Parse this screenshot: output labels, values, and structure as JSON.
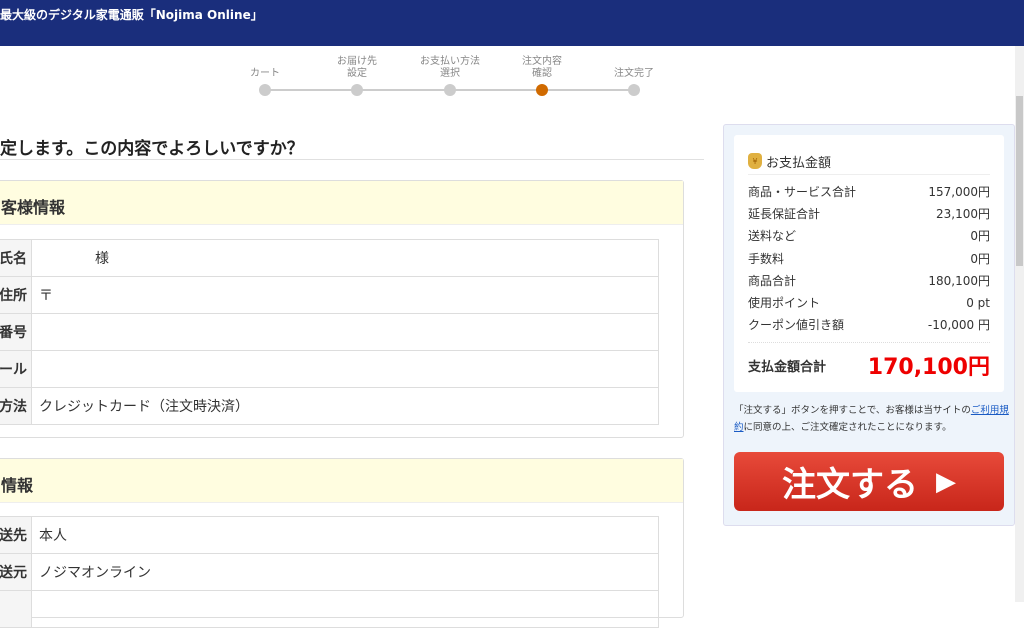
{
  "header": {
    "title": "最大級のデジタル家電通販「Nojima Online」"
  },
  "steps": [
    {
      "label": "カート",
      "active": false
    },
    {
      "label": "お届け先\n設定",
      "active": false
    },
    {
      "label": "お支払い方法\n選択",
      "active": false
    },
    {
      "label": "注文内容\n確認",
      "active": true
    },
    {
      "label": "注文完了",
      "active": false
    }
  ],
  "colors": {
    "active_step": "#d06a00",
    "header": "#1a2e7c",
    "total": "#e00000"
  },
  "page_title": "定します。この内容でよろしいですか？",
  "customer": {
    "heading": "客様情報",
    "rows": [
      {
        "k": "氏名",
        "v": "　　　　様"
      },
      {
        "k": "住所",
        "v": "〒"
      },
      {
        "k": "番号",
        "v": ""
      },
      {
        "k": "ール",
        "v": ""
      },
      {
        "k": "方法",
        "v": "クレジットカード（注文時決済）"
      }
    ]
  },
  "delivery": {
    "heading": "情報",
    "rows": [
      {
        "k": "送先",
        "v": "本人"
      },
      {
        "k": "送元",
        "v": "ノジマオンライン"
      }
    ]
  },
  "summary": {
    "title": "お支払金額",
    "rows": [
      {
        "k": "商品・サービス合計",
        "v": "157,000円"
      },
      {
        "k": "延長保証合計",
        "v": "23,100円"
      },
      {
        "k": "送料など",
        "v": "0円"
      },
      {
        "k": "手数料",
        "v": "0円"
      },
      {
        "k": "商品合計",
        "v": "180,100円"
      },
      {
        "k": "使用ポイント",
        "v": "0 pt"
      },
      {
        "k": "クーポン値引き額",
        "v": "-10,000 円"
      }
    ],
    "total_label": "支払金額合計",
    "total_value": "170,100円"
  },
  "note": {
    "before": "「注文する」ボタンを押すことで、お客様は当サイトの",
    "link": "ご利用規約",
    "after": "に同意の上、ご注文確定されたことになります。"
  },
  "order_button": {
    "label": "注文する",
    "arrow": "▶"
  }
}
